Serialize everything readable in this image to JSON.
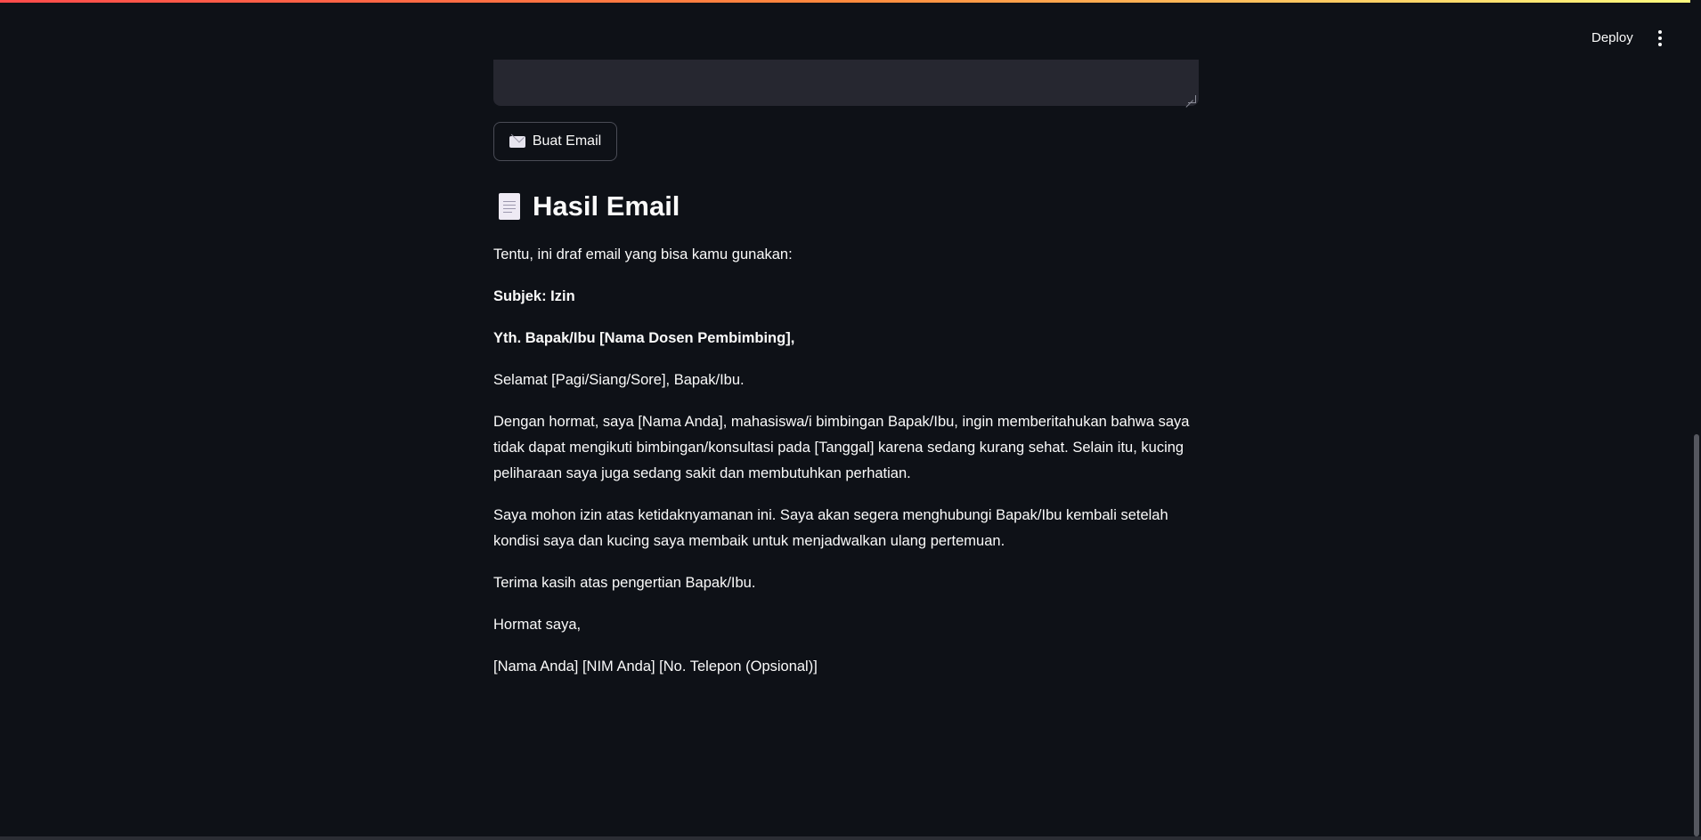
{
  "header": {
    "deploy_label": "Deploy",
    "menu_icon": "more-vertical-icon"
  },
  "form": {
    "textarea_value": "",
    "create_button": {
      "icon": "envelope-icon",
      "label": "Buat Email"
    }
  },
  "result": {
    "icon": "document-icon",
    "title": "Hasil Email",
    "paragraphs": [
      {
        "text": "Tentu, ini draf email yang bisa kamu gunakan:",
        "bold": false
      },
      {
        "text": "Subjek: Izin",
        "bold": true
      },
      {
        "text": "Yth. Bapak/Ibu [Nama Dosen Pembimbing],",
        "bold": true
      },
      {
        "text": "Selamat [Pagi/Siang/Sore], Bapak/Ibu.",
        "bold": false
      },
      {
        "text": "Dengan hormat, saya [Nama Anda], mahasiswa/i bimbingan Bapak/Ibu, ingin memberitahukan bahwa saya tidak dapat mengikuti bimbingan/konsultasi pada [Tanggal] karena sedang kurang sehat. Selain itu, kucing peliharaan saya juga sedang sakit dan membutuhkan perhatian.",
        "bold": false
      },
      {
        "text": "Saya mohon izin atas ketidaknyamanan ini. Saya akan segera menghubungi Bapak/Ibu kembali setelah kondisi saya dan kucing saya membaik untuk menjadwalkan ulang pertemuan.",
        "bold": false
      },
      {
        "text": "Terima kasih atas pengertian Bapak/Ibu.",
        "bold": false
      },
      {
        "text": "Hormat saya,",
        "bold": false
      },
      {
        "text": "[Nama Anda] [NIM Anda] [No. Telepon (Opsional)]",
        "bold": false
      }
    ]
  },
  "colors": {
    "background": "#0e1117",
    "input_background": "#262730",
    "text": "#fafafa",
    "accent_gradient_start": "#ff4b4b",
    "accent_gradient_end": "#fffd80"
  }
}
